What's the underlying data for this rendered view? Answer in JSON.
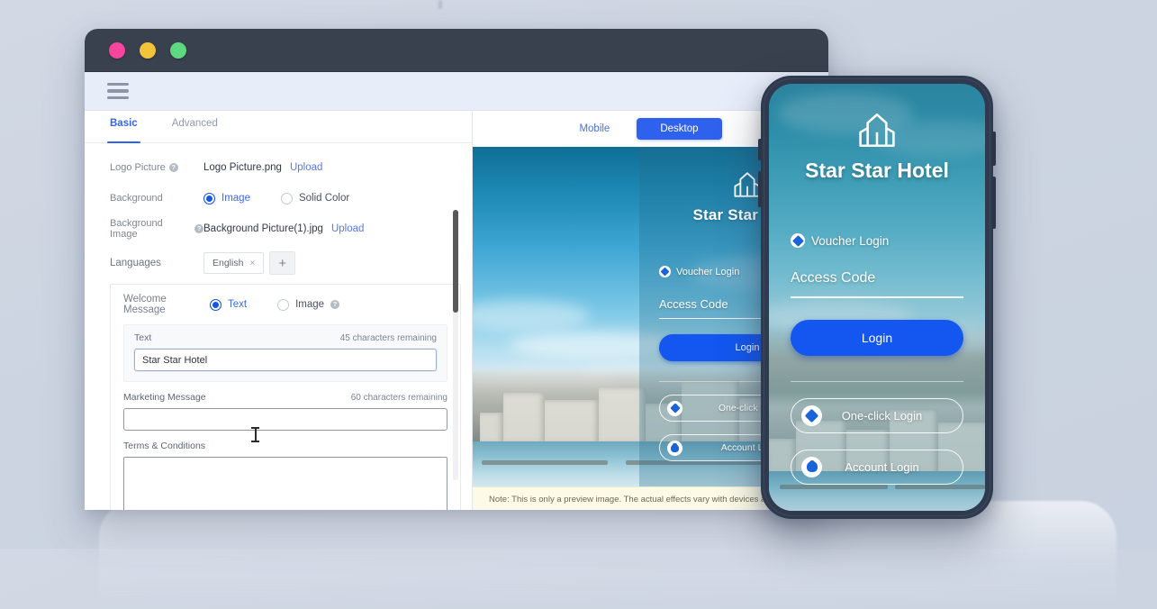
{
  "window": {
    "traffic_lights": [
      "close",
      "minimize",
      "maximize"
    ],
    "menu_icon": "hamburger-menu-icon"
  },
  "settings": {
    "tabs": [
      {
        "label": "Basic",
        "active": true
      },
      {
        "label": "Advanced",
        "active": false
      }
    ],
    "rows": {
      "logo_picture": {
        "label": "Logo Picture",
        "value": "Logo Picture.png",
        "upload_label": "Upload",
        "has_help": true
      },
      "background": {
        "label": "Background",
        "options": [
          {
            "label": "Image",
            "selected": true
          },
          {
            "label": "Solid Color",
            "selected": false
          }
        ]
      },
      "background_image": {
        "label": "Background Image",
        "value": "Background Picture(1).jpg",
        "upload_label": "Upload",
        "has_help": true
      },
      "languages": {
        "label": "Languages",
        "chips": [
          {
            "label": "English",
            "close": "×"
          }
        ],
        "add_label": "+"
      }
    },
    "welcome_message": {
      "label": "Welcome Message",
      "options": [
        {
          "label": "Text",
          "selected": true
        },
        {
          "label": "Image",
          "selected": false,
          "has_help": true
        }
      ],
      "text_field": {
        "label": "Text",
        "counter": "45  characters remaining",
        "value": "Star Star Hotel"
      }
    },
    "marketing_message": {
      "label": "Marketing Message",
      "counter": "60  characters remaining",
      "value": ""
    },
    "terms": {
      "label": "Terms & Conditions",
      "value": ""
    }
  },
  "preview": {
    "tabs": [
      {
        "label": "Mobile",
        "active": false
      },
      {
        "label": "Desktop",
        "active": true
      }
    ],
    "portal": {
      "brand": "Star Star Hotel",
      "voucher_login": "Voucher Login",
      "access_code": "Access Code",
      "login_button": "Login",
      "one_click_login": "One-click Login",
      "account_login": "Account Login"
    },
    "note": "Note: This is only a preview image. The actual effects vary with devices at diffe"
  },
  "phone": {
    "brand": "Star Star Hotel",
    "voucher_login": "Voucher Login",
    "access_code": "Access Code",
    "login_button": "Login",
    "one_click_login": "One-click Login",
    "account_login": "Account Login"
  },
  "colors": {
    "accent_blue": "#2e62ee",
    "link_blue": "#5b77e8",
    "login_blue": "#1356f0",
    "chrome_dark": "#39414f",
    "page_bg": "#ccd4e1",
    "note_bg": "#fdfbe8"
  }
}
